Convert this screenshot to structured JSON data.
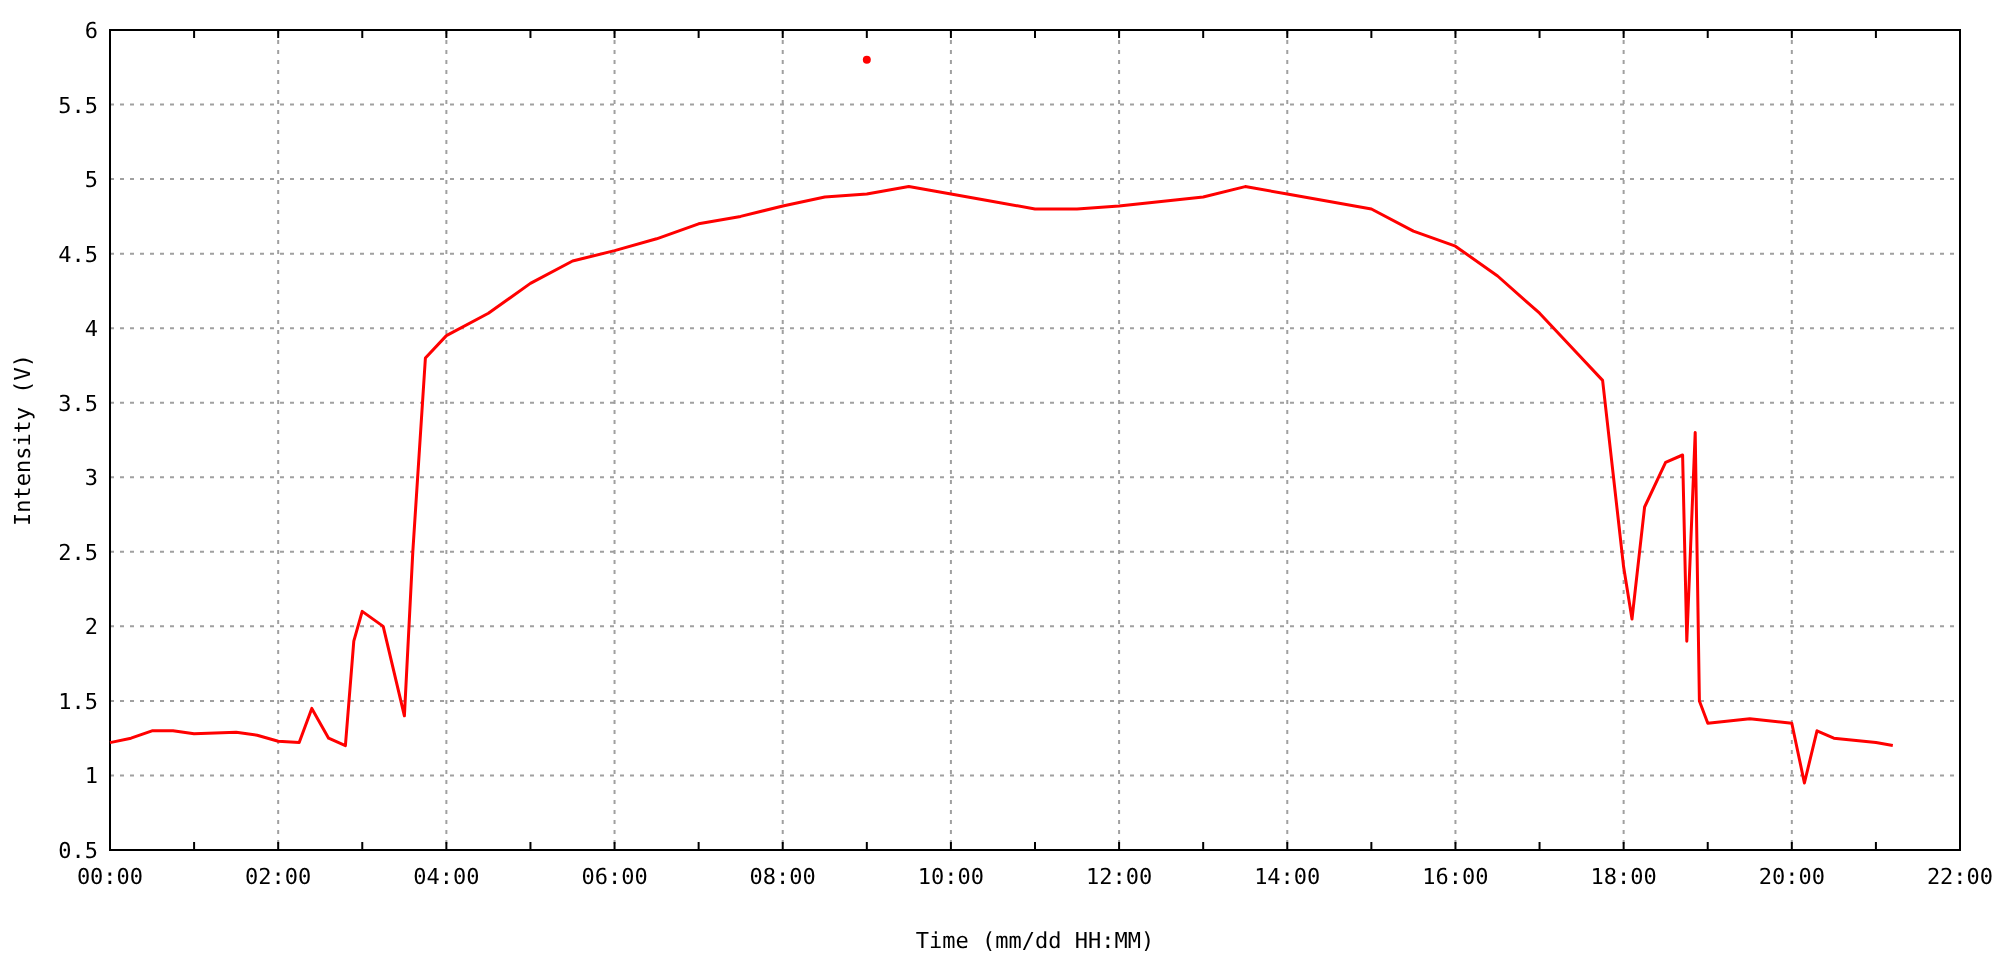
{
  "chart": {
    "chart_data": {
      "type": "line",
      "grid": true,
      "xlabel": "Time (mm/dd HH:MM)",
      "ylabel": "Intensity (V)",
      "x": [
        0,
        0.25,
        0.5,
        0.75,
        1,
        1.5,
        1.75,
        2,
        2.25,
        2.4,
        2.6,
        2.8,
        2.9,
        3,
        3.25,
        3.5,
        3.6,
        3.75,
        4,
        4.5,
        5,
        5.5,
        6,
        6.5,
        7,
        7.5,
        8,
        8.5,
        9,
        9.5,
        10,
        10.5,
        11,
        11.5,
        12,
        12.5,
        13,
        13.5,
        14,
        14.5,
        15,
        15.5,
        16,
        16.5,
        17,
        17.5,
        17.75,
        18,
        18.1,
        18.25,
        18.5,
        18.7,
        18.75,
        18.85,
        18.9,
        19,
        19.5,
        20,
        20.15,
        20.3,
        20.5,
        21,
        21.2
      ],
      "series": [
        {
          "color": "#ff0000",
          "values": [
            1.22,
            1.25,
            1.3,
            1.3,
            1.28,
            1.29,
            1.27,
            1.23,
            1.22,
            1.45,
            1.25,
            1.2,
            1.9,
            2.1,
            2.0,
            1.4,
            2.5,
            3.8,
            3.95,
            4.1,
            4.3,
            4.45,
            4.52,
            4.6,
            4.7,
            4.75,
            4.82,
            4.88,
            4.9,
            4.95,
            4.9,
            4.85,
            4.8,
            4.8,
            4.82,
            4.85,
            4.88,
            4.95,
            4.9,
            4.85,
            4.8,
            4.65,
            4.55,
            4.35,
            4.1,
            3.8,
            3.65,
            2.4,
            2.05,
            2.8,
            3.1,
            3.15,
            1.9,
            3.3,
            1.5,
            1.35,
            1.38,
            1.35,
            0.95,
            1.3,
            1.25,
            1.22,
            1.2
          ]
        },
        {
          "color": "#ff0000",
          "marker": "circle",
          "values": [
            null,
            null,
            null,
            null,
            null,
            null,
            null,
            null,
            null,
            null,
            null,
            null,
            null,
            null,
            null,
            null,
            null,
            null,
            null,
            null,
            null,
            null,
            null,
            null,
            null,
            null,
            null,
            null,
            5.8,
            null,
            null,
            null,
            null,
            null,
            null,
            null,
            null,
            null,
            null,
            null,
            null,
            null,
            null,
            null,
            null,
            null,
            null,
            null,
            null,
            null,
            null,
            null,
            null,
            null,
            null,
            null,
            null,
            null,
            null,
            null,
            null,
            null,
            null
          ]
        }
      ],
      "xlim": [
        0,
        22
      ],
      "ylim": [
        0.5,
        6
      ],
      "xticks": [
        {
          "value": 0,
          "label": "00:00"
        },
        {
          "value": 2,
          "label": "02:00"
        },
        {
          "value": 4,
          "label": "04:00"
        },
        {
          "value": 6,
          "label": "06:00"
        },
        {
          "value": 8,
          "label": "08:00"
        },
        {
          "value": 10,
          "label": "10:00"
        },
        {
          "value": 12,
          "label": "12:00"
        },
        {
          "value": 14,
          "label": "14:00"
        },
        {
          "value": 16,
          "label": "16:00"
        },
        {
          "value": 18,
          "label": "18:00"
        },
        {
          "value": 20,
          "label": "20:00"
        },
        {
          "value": 22,
          "label": "22:00"
        }
      ],
      "yticks": [
        0.5,
        1,
        1.5,
        2,
        2.5,
        3,
        3.5,
        4,
        4.5,
        5,
        5.5,
        6
      ]
    }
  }
}
